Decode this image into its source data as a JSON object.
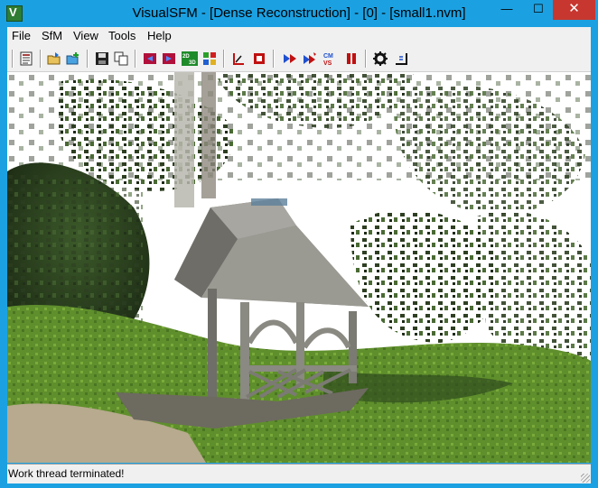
{
  "window": {
    "title": "VisualSFM - [Dense Reconstruction] - [0] - [small1.nvm]",
    "minimize_glyph": "—",
    "maximize_glyph": "☐",
    "close_glyph": "✕"
  },
  "menu": {
    "items": [
      "File",
      "SfM",
      "View",
      "Tools",
      "Help"
    ]
  },
  "toolbar": {
    "buttons": [
      {
        "icon": "log-window-icon"
      },
      {
        "icon": "open-folder-icon"
      },
      {
        "icon": "add-images-icon"
      },
      {
        "icon": "save-nvm-icon"
      },
      {
        "icon": "copy-icon"
      },
      {
        "icon": "prev-model-icon"
      },
      {
        "icon": "next-model-icon"
      },
      {
        "icon": "toggle-2d-3d-icon",
        "label": "2D 3D"
      },
      {
        "icon": "thumbnails-icon"
      },
      {
        "icon": "pointer-tool-icon"
      },
      {
        "icon": "stop-icon"
      },
      {
        "icon": "compute-matching-icon"
      },
      {
        "icon": "reconstruct-sparse-icon"
      },
      {
        "icon": "reconstruct-dense-icon",
        "label": "CMVS"
      },
      {
        "icon": "pause-icon"
      },
      {
        "icon": "settings-gear-icon"
      },
      {
        "icon": "show-features-icon"
      }
    ]
  },
  "colors": {
    "title_bar": "#1ba1e2",
    "close_button": "#c7372f",
    "chrome": "#f0f0f0"
  },
  "statusbar": {
    "text": "Work thread terminated!"
  }
}
